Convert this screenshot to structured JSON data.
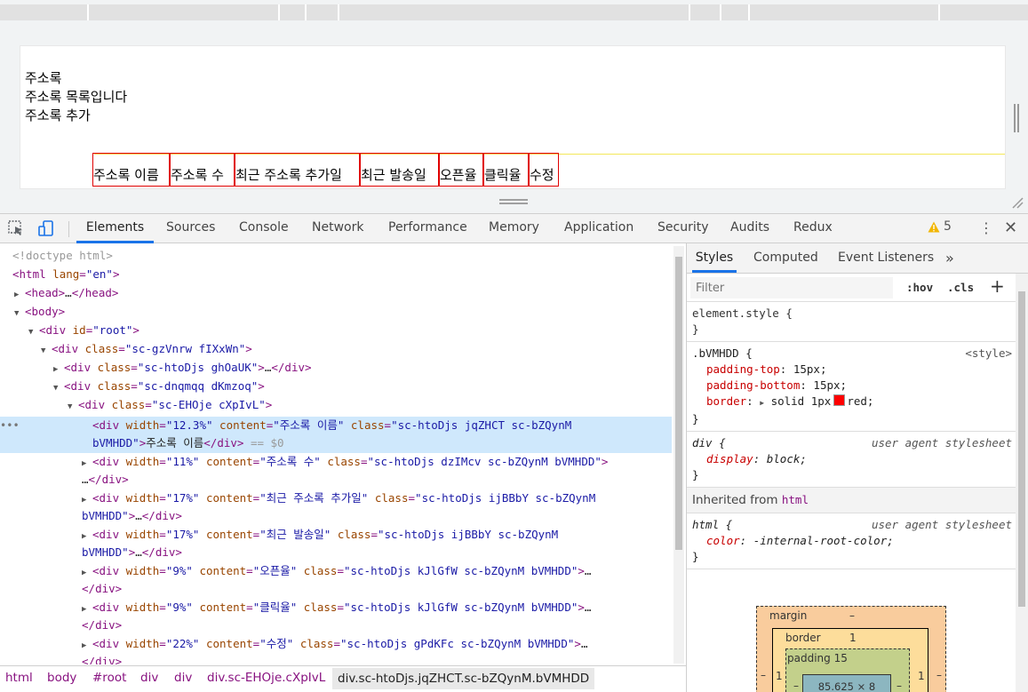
{
  "page": {
    "lines": [
      "주소록",
      "주소록 목록입니다",
      "주소록 추가"
    ],
    "table_cells": [
      "주소록 이름",
      "주소록 수",
      "최근 주소록 추가일",
      "최근 발송일",
      "오픈율",
      "클릭율",
      "수정"
    ]
  },
  "devtools": {
    "tabs": [
      "Elements",
      "Sources",
      "Console",
      "Network",
      "Performance",
      "Memory",
      "Application",
      "Security",
      "Audits",
      "Redux"
    ],
    "active_tab": "Elements",
    "warning_count": "5"
  },
  "elements_tree": {
    "doctype": "<!doctype html>",
    "html_tag": "html",
    "html_lang_attr": "lang",
    "html_lang": "en",
    "head_tag": "head",
    "body_tag": "body",
    "root_id": "root",
    "div_tag": "div",
    "class_attr": "class",
    "id_attr": "id",
    "width_attr": "width",
    "content_attr": "content",
    "ellipsis": "…",
    "div1_class": "sc-gzVnrw fIXxWn",
    "div2_class": "sc-htoDjs ghOaUK",
    "div3_class": "sc-dnqmqq dKmzoq",
    "div4_class": "sc-EHOje cXpIvL",
    "selected_eq": " == $0",
    "selected_dots": "•••",
    "rows": [
      {
        "width": "12.3%",
        "content": "주소록 이름",
        "class_a": "sc-htoDjs jqZHCT sc-bZQynM",
        "class_b": "bVMHDD",
        "text": "주소록 이름"
      },
      {
        "width": "11%",
        "content": "주소록 수",
        "class": "sc-htoDjs dzIMcv sc-bZQynM bVMHDD"
      },
      {
        "width": "17%",
        "content": "최근 주소록 추가일",
        "class_a": "sc-htoDjs ijBBbY sc-bZQynM",
        "class_b": "bVMHDD"
      },
      {
        "width": "17%",
        "content": "최근 발송일",
        "class_a": "sc-htoDjs ijBBbY sc-bZQynM",
        "class_b": "bVMHDD"
      },
      {
        "width": "9%",
        "content": "오픈율",
        "class": "sc-htoDjs kJlGfW sc-bZQynM bVMHDD"
      },
      {
        "width": "9%",
        "content": "클릭율",
        "class": "sc-htoDjs kJlGfW sc-bZQynM bVMHDD"
      },
      {
        "width": "22%",
        "content": "수정",
        "class": "sc-htoDjs gPdKFc sc-bZQynM bVMHDD"
      }
    ]
  },
  "breadcrumbs": [
    "html",
    "body",
    "#root",
    "div",
    "div",
    "div.sc-EHOje.cXpIvL",
    "div.sc-htoDjs.jqZHCT.sc-bZQynM.bVMHDD"
  ],
  "styles": {
    "subtabs": [
      "Styles",
      "Computed",
      "Event Listeners"
    ],
    "more": "»",
    "filter_placeholder": "Filter",
    "hov": ":hov",
    "cls": ".cls",
    "plus": "+",
    "element_style_selector": "element.style {",
    "close_brace": "}",
    "rule1_selector": ".bVMHDD {",
    "rule1_source": "<style>",
    "rule1_props": [
      {
        "name": "padding-top",
        "value": "15px;"
      },
      {
        "name": "padding-bottom",
        "value": "15px;"
      },
      {
        "name": "border",
        "value_prefix": "solid 1px",
        "value_suffix": "red;"
      }
    ],
    "rule2_selector": "div {",
    "rule2_source": "user agent stylesheet",
    "rule2_prop": {
      "name": "display",
      "value": "block;"
    },
    "inherited_label": "Inherited from",
    "inherited_tag": "html",
    "rule3_selector": "html {",
    "rule3_source": "user agent stylesheet",
    "rule3_prop": {
      "name": "color",
      "value": "-internal-root-color;"
    }
  },
  "box_model": {
    "margin_label": "margin",
    "margin_value": "–",
    "border_label": "border",
    "border_value": "1",
    "padding_label": "padding",
    "padding_value": "15",
    "content_size": "85.625 × 8",
    "side_left": "1",
    "side_dash": "–"
  },
  "colors": {
    "accent": "#1a73e8",
    "selection": "#cfe8fc",
    "cell_border": "#e00000",
    "warning": "#f2b600"
  }
}
